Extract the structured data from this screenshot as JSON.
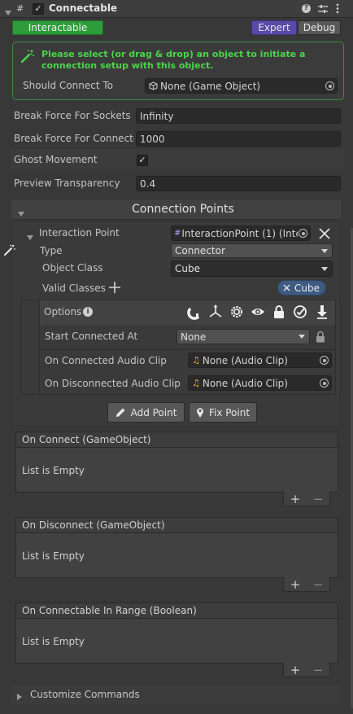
{
  "header": {
    "title": "Connectable",
    "enabled": true,
    "icons": [
      "help-icon",
      "presets-icon",
      "kebab-menu-icon"
    ]
  },
  "status": {
    "interactable_label": "Interactable"
  },
  "mode_buttons": {
    "expert": "Expert",
    "debug": "Debug"
  },
  "info_box": {
    "message": "Please select (or drag & drop) an object to initiate a connection setup with this object.",
    "color": "#4bd44b"
  },
  "should_connect": {
    "label": "Should Connect To",
    "value": "None (Game Object)"
  },
  "fields": {
    "break_sockets": {
      "label": "Break Force For Sockets",
      "value": "Infinity"
    },
    "break_connectors": {
      "label": "Break Force For Connecto",
      "value": "1000"
    },
    "ghost_movement": {
      "label": "Ghost Movement",
      "checked": true
    },
    "preview_transparency": {
      "label": "Preview Transparency",
      "value": "0.4"
    }
  },
  "connection_points": {
    "title": "Connection Points",
    "point": {
      "label": "Interaction Point",
      "value": "InteractionPoint (1) (Intera",
      "type_label": "Type",
      "type_value": "Connector",
      "class_label": "Object Class",
      "class_value": "Cube",
      "valid_label": "Valid Classes",
      "valid_tag": "Cube",
      "options_label": "Options",
      "option_icons": [
        "magnet-icon",
        "axes-icon",
        "gear-icon",
        "eye-icon",
        "lock-icon",
        "check-circle-icon",
        "download-arrow-icon"
      ],
      "start_label": "Start Connected At",
      "start_value": "None",
      "on_connected_audio_label": "On Connected Audio Clip",
      "on_connected_audio_value": "None (Audio Clip)",
      "on_disconnected_audio_label": "On Disconnected Audio Clip",
      "on_disconnected_audio_value": "None (Audio Clip)"
    },
    "add_point": "Add Point",
    "fix_point": "Fix Point"
  },
  "events": [
    {
      "title": "On Connect (GameObject)",
      "empty": "List is Empty"
    },
    {
      "title": "On Disconnect (GameObject)",
      "empty": "List is Empty"
    },
    {
      "title": "On Connectable In Range (Boolean)",
      "empty": "List is Empty"
    }
  ],
  "list_controls": {
    "add": "+",
    "remove": "−"
  },
  "customize": {
    "label": "Customize Commands"
  }
}
